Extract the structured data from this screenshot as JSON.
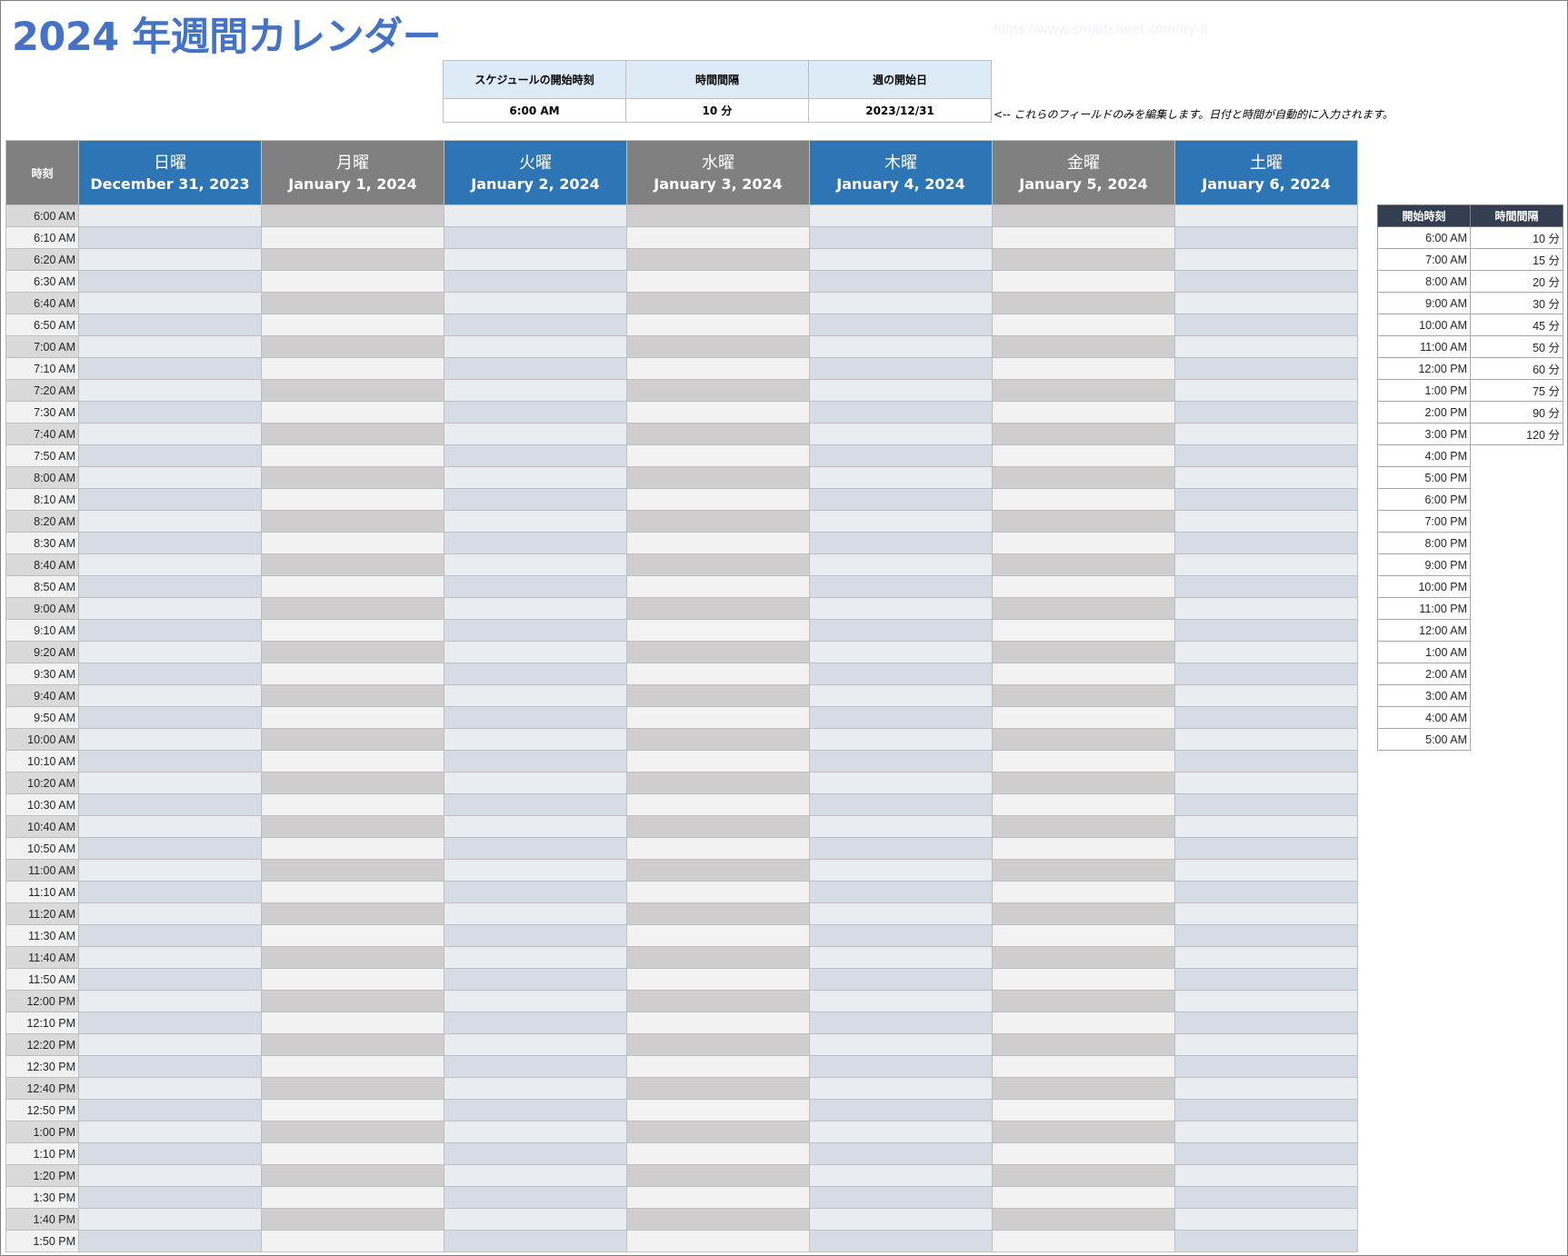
{
  "title": "2024 年週間カレンダー",
  "watermark_link": "https://www.smartsheet.com/try-it",
  "settings": {
    "headers": [
      "スケジュールの開始時刻",
      "時間間隔",
      "週の開始日"
    ],
    "values": [
      "6:00 AM",
      "10 分",
      "2023/12/31"
    ]
  },
  "note": "<--  これらのフィールドのみを編集します。日付と時間が自動的に入力されます。",
  "calendar": {
    "time_header": "時刻",
    "days": [
      {
        "name": "日曜",
        "date": "December 31, 2023",
        "color": "blue"
      },
      {
        "name": "月曜",
        "date": "January 1, 2024",
        "color": "gray"
      },
      {
        "name": "火曜",
        "date": "January 2, 2024",
        "color": "blue"
      },
      {
        "name": "水曜",
        "date": "January 3, 2024",
        "color": "gray"
      },
      {
        "name": "木曜",
        "date": "January 4, 2024",
        "color": "blue"
      },
      {
        "name": "金曜",
        "date": "January 5, 2024",
        "color": "gray"
      },
      {
        "name": "土曜",
        "date": "January 6, 2024",
        "color": "blue"
      }
    ],
    "times": [
      "6:00 AM",
      "6:10 AM",
      "6:20 AM",
      "6:30 AM",
      "6:40 AM",
      "6:50 AM",
      "7:00 AM",
      "7:10 AM",
      "7:20 AM",
      "7:30 AM",
      "7:40 AM",
      "7:50 AM",
      "8:00 AM",
      "8:10 AM",
      "8:20 AM",
      "8:30 AM",
      "8:40 AM",
      "8:50 AM",
      "9:00 AM",
      "9:10 AM",
      "9:20 AM",
      "9:30 AM",
      "9:40 AM",
      "9:50 AM",
      "10:00 AM",
      "10:10 AM",
      "10:20 AM",
      "10:30 AM",
      "10:40 AM",
      "10:50 AM",
      "11:00 AM",
      "11:10 AM",
      "11:20 AM",
      "11:30 AM",
      "11:40 AM",
      "11:50 AM",
      "12:00 PM",
      "12:10 PM",
      "12:20 PM",
      "12:30 PM",
      "12:40 PM",
      "12:50 PM",
      "1:00 PM",
      "1:10 PM",
      "1:20 PM",
      "1:30 PM",
      "1:40 PM",
      "1:50 PM"
    ]
  },
  "lookup": {
    "headers": [
      "開始時刻",
      "時間間隔"
    ],
    "start_times": [
      "6:00 AM",
      "7:00 AM",
      "8:00 AM",
      "9:00 AM",
      "10:00 AM",
      "11:00 AM",
      "12:00 PM",
      "1:00 PM",
      "2:00 PM",
      "3:00 PM",
      "4:00 PM",
      "5:00 PM",
      "6:00 PM",
      "7:00 PM",
      "8:00 PM",
      "9:00 PM",
      "10:00 PM",
      "11:00 PM",
      "12:00 AM",
      "1:00 AM",
      "2:00 AM",
      "3:00 AM",
      "4:00 AM",
      "5:00 AM"
    ],
    "intervals": [
      "10 分",
      "15 分",
      "20 分",
      "30 分",
      "45 分",
      "50 分",
      "60 分",
      "75 分",
      "90 分",
      "120 分"
    ]
  },
  "colors": {
    "title": "#4472C4",
    "header_blue": "#2E75B6",
    "header_gray": "#808080",
    "settings_header": "#DDEBF7",
    "lookup_header": "#333F50"
  }
}
